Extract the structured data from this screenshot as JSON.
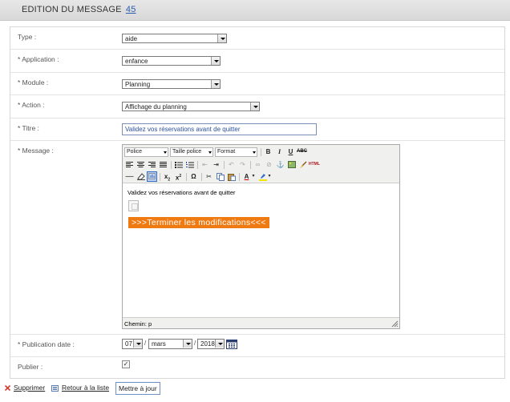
{
  "header": {
    "title": "EDITION DU MESSAGE",
    "message_id": "45"
  },
  "form": {
    "type": {
      "label": "Type :",
      "value": "aide"
    },
    "application": {
      "label": "* Application :",
      "value": "enfance"
    },
    "module": {
      "label": "* Module :",
      "value": "Planning"
    },
    "action": {
      "label": "* Action :",
      "value": "Affichage du planning"
    },
    "titre": {
      "label": "* Titre :",
      "value": "Validez vos réservations avant de quitter"
    },
    "message": {
      "label": "* Message :",
      "toolbar": {
        "font": "Police",
        "size": "Taille police",
        "format": "Format"
      },
      "content": {
        "paragraph": "Validez vos réservations avant de quitter",
        "banner": ">>>Terminer les modifications<<<"
      },
      "status_path": "Chemin: p"
    },
    "publication_date": {
      "label": "* Publication date :",
      "day": "07",
      "month": "mars",
      "year": "2018"
    },
    "publier": {
      "label": "Publier :",
      "checked": true,
      "check_glyph": "✓"
    }
  },
  "actions": {
    "delete_label": "Supprimer",
    "back_label": "Retour à la liste",
    "update_label": "Mettre à jour"
  },
  "colors": {
    "banner": "#f07a12",
    "link": "#2a5db0",
    "delete_icon": "#d9332a"
  }
}
